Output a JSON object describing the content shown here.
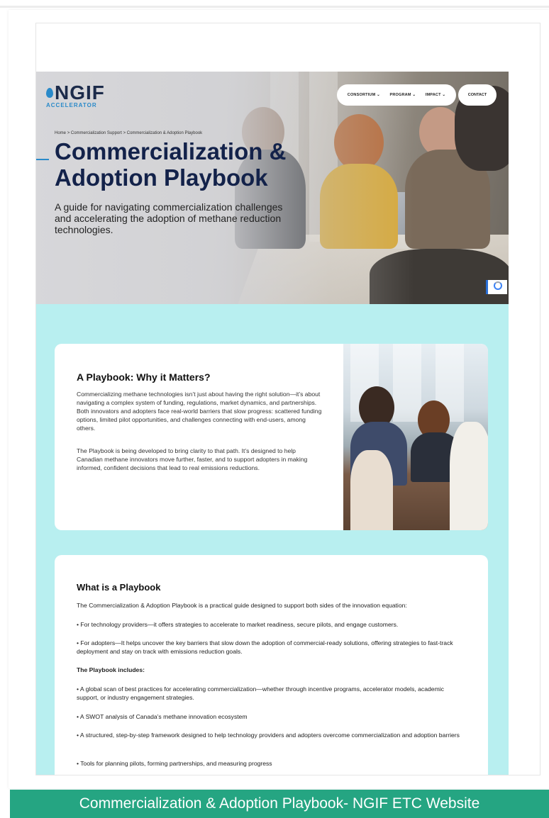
{
  "brand": {
    "name": "NGIF",
    "sub": "ACCELERATOR",
    "accent": "#2a8ac9",
    "navy": "#13224a"
  },
  "nav": {
    "items": [
      {
        "label": "CONSORTIUM",
        "active": false
      },
      {
        "label": "PROGRAM",
        "active": true
      },
      {
        "label": "IMPACT",
        "active": false
      }
    ],
    "contact": "CONTACT",
    "chevron": "⌄"
  },
  "breadcrumb": [
    "Home",
    "Commercialization Support",
    "Commercialization & Adoption Playbook"
  ],
  "breadcrumb_sep": ">",
  "hero": {
    "title_line1": "Commercialization &",
    "title_line2": "Adoption Playbook",
    "lead": "A guide for navigating commercialization challenges and accelerating the adoption of methane reduction technologies."
  },
  "section1": {
    "heading": "A Playbook: Why it Matters?",
    "p1": "Commercializing methane technologies isn’t just about having the right solution—it’s about navigating a complex system of funding, regulations, market dynamics, and partnerships. Both innovators and adopters face real-world barriers that slow progress: scattered funding options, limited pilot opportunities, and challenges connecting with end-users, among others.",
    "p2": "The Playbook is being developed to bring clarity to that path. It’s designed to help Canadian methane innovators move further, faster, and to support adopters in making informed, confident decisions that lead to real emissions reductions."
  },
  "section2": {
    "heading": "What is a Playbook",
    "intro": "The Commercialization & Adoption Playbook is a practical guide designed to support both sides of the innovation equation:",
    "b1": "• For technology providers—it offers strategies to accelerate to market readiness, secure pilots, and engage customers.",
    "b2": "• For adopters—It helps uncover the key barriers that slow down the adoption of commercial-ready solutions, offering strategies to fast-track deployment and stay on track with emissions reduction goals.",
    "includes": "The Playbook includes:",
    "i1": "• A global scan of best practices for accelerating commercialization—whether through incentive programs, accelerator models, academic support, or industry engagement strategies.",
    "i2": "• A SWOT analysis of Canada’s methane innovation ecosystem",
    "i3": "• A structured, step-by-step framework designed to help technology providers and adopters overcome commercialization and adoption barriers",
    "i4": "• Tools for planning pilots, forming partnerships, and measuring progress"
  },
  "colors": {
    "teal_bg": "#b8eff0",
    "caption_bg": "#25a582",
    "active_nav": "#2ca58d"
  },
  "caption": "Commercialization & Adoption Playbook- NGIF ETC Website"
}
